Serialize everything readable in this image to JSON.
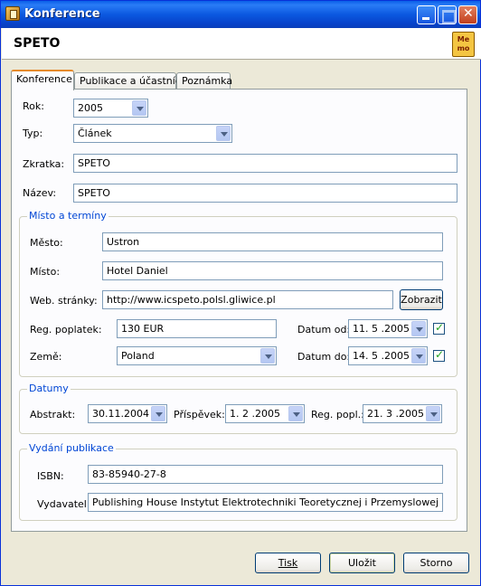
{
  "window": {
    "title": "Konference"
  },
  "header": {
    "title": "SPETO",
    "icon_text": "Me mo"
  },
  "tabs": [
    {
      "label": "Konference"
    },
    {
      "label": "Publikace a účastníci"
    },
    {
      "label": "Poznámka"
    }
  ],
  "form": {
    "rok": {
      "label": "Rok:",
      "value": "2005"
    },
    "typ": {
      "label": "Typ:",
      "value": "Článek"
    },
    "zkratka": {
      "label": "Zkratka:",
      "value": "SPETO"
    },
    "nazev": {
      "label": "Název:",
      "value": "SPETO"
    }
  },
  "misto_group": {
    "title": "Místo a termíny",
    "mesto": {
      "label": "Město:",
      "value": "Ustron"
    },
    "misto": {
      "label": "Místo:",
      "value": "Hotel Daniel"
    },
    "web": {
      "label": "Web. stránky:",
      "value": "http://www.icspeto.polsl.gliwice.pl",
      "button": "Zobrazit"
    },
    "poplatek": {
      "label": "Reg. poplatek:",
      "value": "130 EUR"
    },
    "zeme": {
      "label": "Země:",
      "value": "Poland"
    },
    "datum_od": {
      "label": "Datum od:",
      "value": "11. 5 .2005"
    },
    "datum_do": {
      "label": "Datum do:",
      "value": "14. 5 .2005"
    }
  },
  "datumy_group": {
    "title": "Datumy",
    "abstrakt": {
      "label": "Abstrakt:",
      "value": "30.11.2004"
    },
    "prispevek": {
      "label": "Příspěvek:",
      "value": " 1. 2 .2005"
    },
    "reg_popl": {
      "label": "Reg. popl.:",
      "value": "21. 3 .2005"
    }
  },
  "vydani_group": {
    "title": "Vydání publikace",
    "isbn": {
      "label": "ISBN:",
      "value": "83-85940-27-8"
    },
    "vydavatel": {
      "label": "Vydavatel:",
      "value": "Publishing House Instytut Elektrotechniki Teoretycznej i Przemyslowej Politechniki"
    }
  },
  "buttons": {
    "tisk": "Tisk",
    "ulozit": "Uložit",
    "storno": "Storno"
  }
}
